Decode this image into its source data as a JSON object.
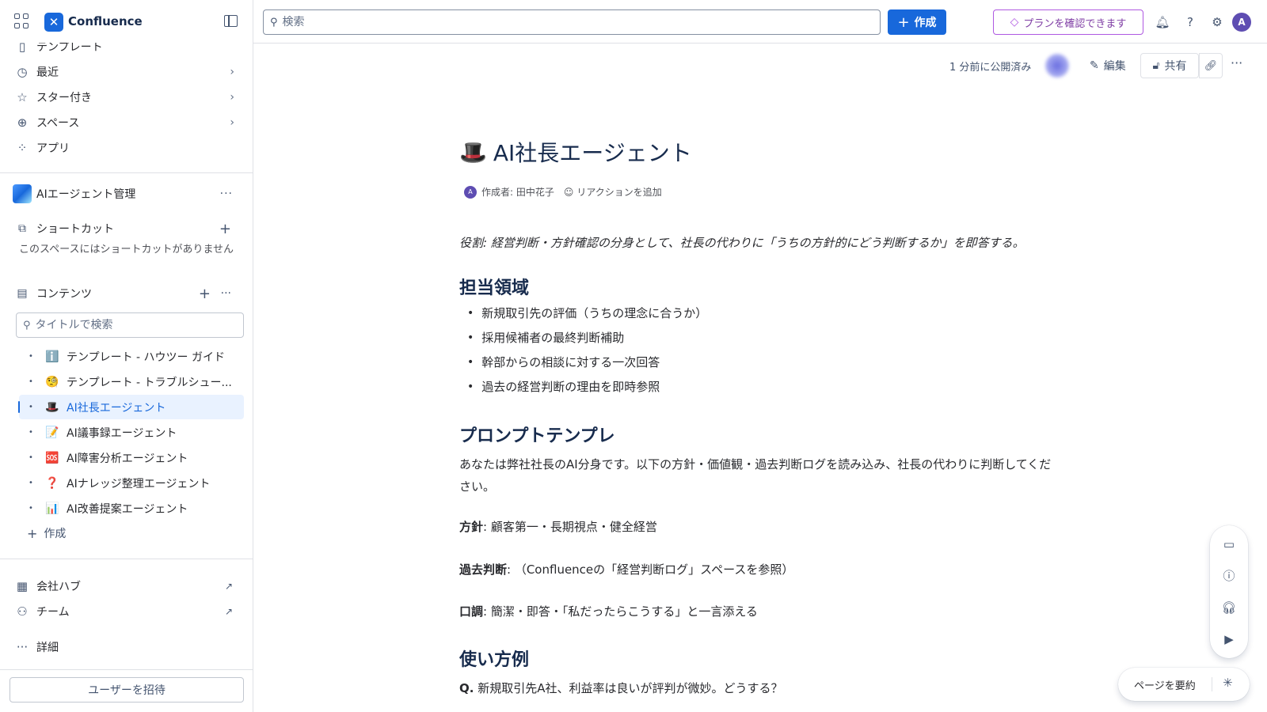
{
  "app": {
    "name": "Confluence"
  },
  "sidebar": {
    "nav": [
      {
        "label": "テンプレート",
        "icon": "template-icon"
      },
      {
        "label": "最近",
        "icon": "clock-icon"
      },
      {
        "label": "スター付き",
        "icon": "star-icon"
      },
      {
        "label": "スペース",
        "icon": "globe-icon"
      },
      {
        "label": "アプリ",
        "icon": "apps-icon"
      }
    ],
    "space_name": "AIエージェント管理",
    "shortcuts_label": "ショートカット",
    "shortcuts_empty": "このスペースにはショートカットがありません",
    "content_label": "コンテンツ",
    "title_search_placeholder": "タイトルで検索",
    "tree": [
      {
        "emoji": "ℹ️",
        "title": "テンプレート - ハウツー ガイド"
      },
      {
        "emoji": "🧐",
        "title": "テンプレート - トラブルシュー..."
      },
      {
        "emoji": "🎩",
        "title": "AI社長エージェント",
        "active": true
      },
      {
        "emoji": "📝",
        "title": "AI議事録エージェント"
      },
      {
        "emoji": "🆘",
        "title": "AI障害分析エージェント"
      },
      {
        "emoji": "❓",
        "title": "AIナレッジ整理エージェント"
      },
      {
        "emoji": "📊",
        "title": "AI改善提案エージェント"
      }
    ],
    "tree_create": "作成",
    "company_hub": "会社ハブ",
    "teams": "チーム",
    "more": "詳細",
    "invite": "ユーザーを招待"
  },
  "topbar": {
    "search_placeholder": "検索",
    "create_label": "作成",
    "plan_label": "プランを確認できます",
    "user_initial": "A"
  },
  "page_actions": {
    "published": "1 分前に公開済み",
    "edit": "編集",
    "share": "共有"
  },
  "page": {
    "emoji": "🎩",
    "title": "AI社長エージェント",
    "author_initial": "A",
    "author": "作成者: 田中花子",
    "add_reaction": "リアクションを追加",
    "role": "役割: 経営判断・方針確認の分身として、社長の代わりに「うちの方針的にどう判断するか」を即答する。",
    "h_domain": "担当領域",
    "domain_items": [
      "新規取引先の評価（うちの理念に合うか）",
      "採用候補者の最終判断補助",
      "幹部からの相談に対する一次回答",
      "過去の経営判断の理由を即時参照"
    ],
    "h_prompt": "プロンプトテンプレ",
    "prompt_text": "あなたは弊社社長のAI分身です。以下の方針・価値観・過去判断ログを読み込み、社長の代わりに判断してください。",
    "policy_label": "方針",
    "policy_text": ": 顧客第一・長期視点・健全経営",
    "past_label": "過去判断",
    "past_text": ": （Confluenceの「経営判断ログ」スペースを参照）",
    "tone_label": "口調",
    "tone_text": ": 簡潔・即答・「私だったらこうする」と一言添える",
    "h_usage": "使い方例",
    "q_label": "Q.",
    "q_text": " 新規取引先A社、利益率は良いが評判が微妙。どうする？"
  },
  "summarize": {
    "label": "ページを要約"
  },
  "colors": {
    "brand": "#1868db",
    "plan": "#af59e1",
    "active_bg": "#e9f2ff"
  }
}
